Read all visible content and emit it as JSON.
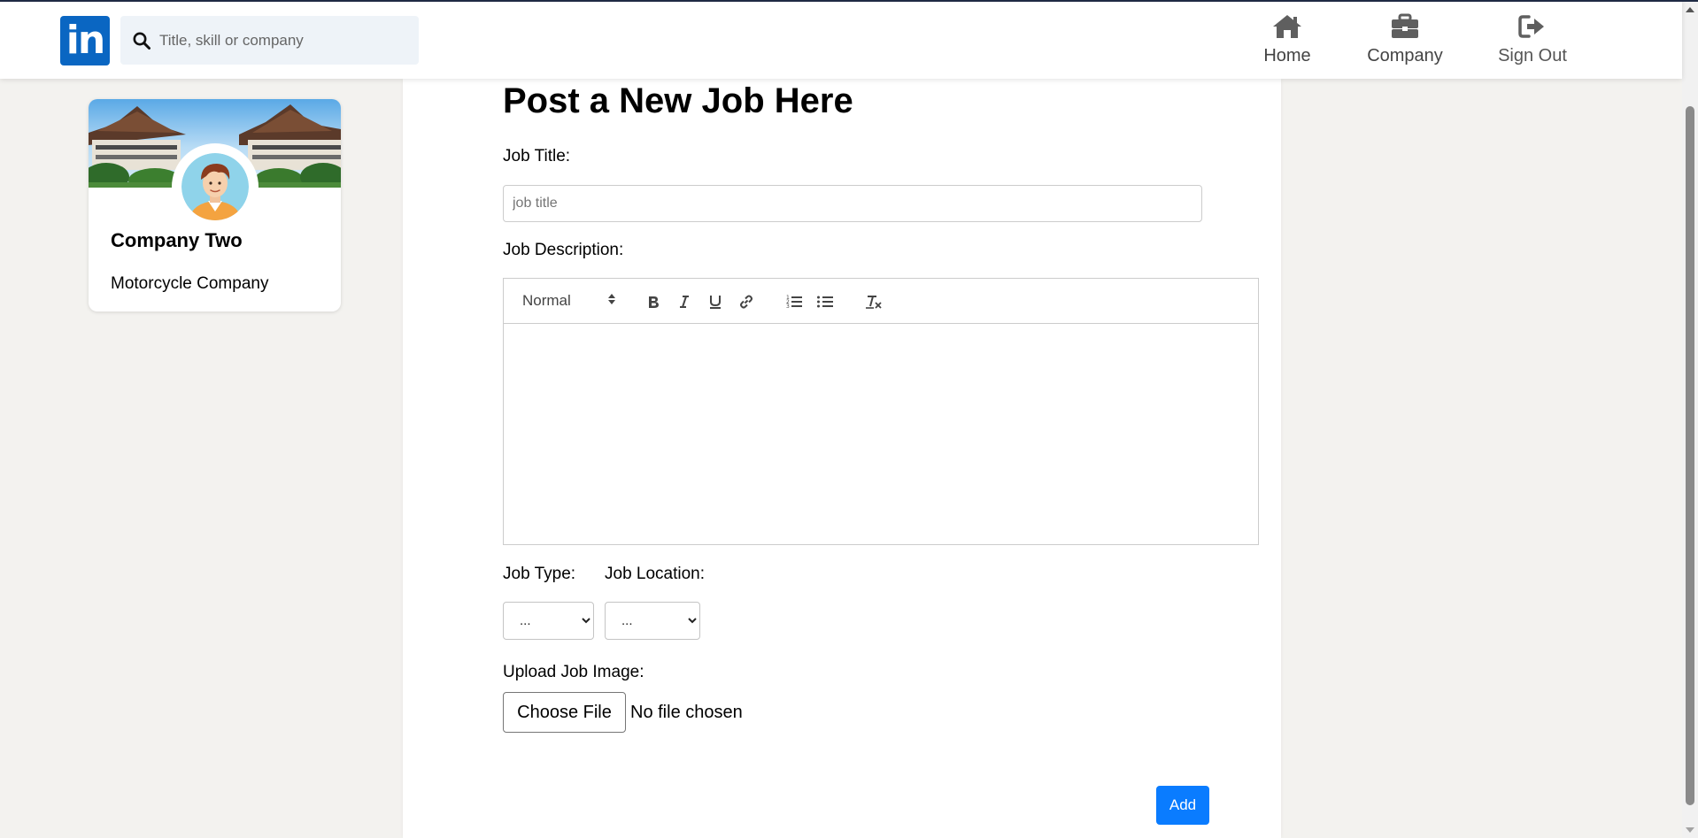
{
  "header": {
    "logo_text": "in",
    "search": {
      "placeholder": "Title, skill or company",
      "icon": "search-icon"
    },
    "nav": [
      {
        "label": "Home",
        "icon": "home-icon"
      },
      {
        "label": "Company",
        "icon": "briefcase-icon"
      },
      {
        "label": "Sign Out",
        "icon": "sign-out-icon"
      }
    ]
  },
  "profile": {
    "name": "Company Two",
    "type": "Motorcycle Company"
  },
  "form": {
    "title": "Post a New Job Here",
    "job_title_label": "Job Title:",
    "job_title_placeholder": "job title",
    "job_title_value": "",
    "description_label": "Job Description:",
    "editor": {
      "format_value": "Normal",
      "tools": [
        "bold-icon",
        "italic-icon",
        "underline-icon",
        "link-icon",
        "ordered-list-icon",
        "bullet-list-icon",
        "clear-format-icon"
      ]
    },
    "job_type_label": "Job Type:",
    "job_type_value": "...",
    "job_location_label": "Job Location:",
    "job_location_value": "...",
    "upload_label": "Upload Job Image:",
    "choose_file_label": "Choose File",
    "file_status": "No file chosen",
    "add_label": "Add"
  },
  "colors": {
    "brand": "#0a66c2",
    "add_button": "#0a7cff",
    "page_background": "#f3f2ef"
  }
}
